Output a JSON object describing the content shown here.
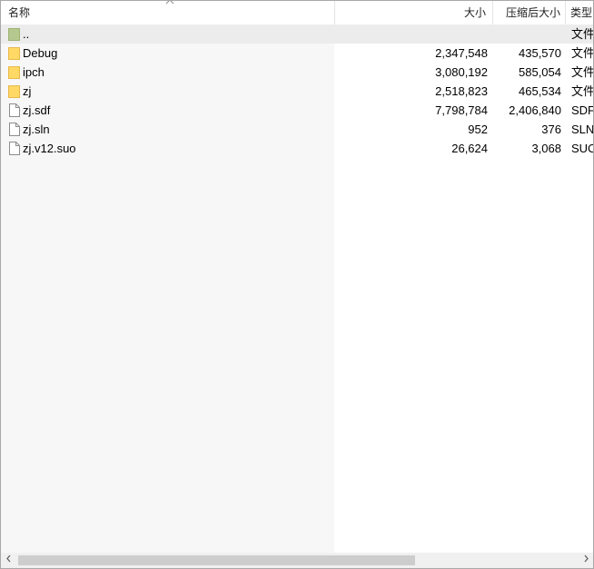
{
  "header": {
    "name": "名称",
    "size": "大小",
    "packed": "压缩后大小",
    "type": "类型",
    "sort_indicator": "^"
  },
  "rows": [
    {
      "icon": "parent-folder-icon",
      "name": "..",
      "size": "",
      "packed": "",
      "type": "文件",
      "selected": true
    },
    {
      "icon": "folder-icon",
      "name": "Debug",
      "size": "2,347,548",
      "packed": "435,570",
      "type": "文件"
    },
    {
      "icon": "folder-icon",
      "name": "ipch",
      "size": "3,080,192",
      "packed": "585,054",
      "type": "文件"
    },
    {
      "icon": "folder-icon",
      "name": "zj",
      "size": "2,518,823",
      "packed": "465,534",
      "type": "文件"
    },
    {
      "icon": "file-icon",
      "name": "zj.sdf",
      "size": "7,798,784",
      "packed": "2,406,840",
      "type": "SDF"
    },
    {
      "icon": "file-icon",
      "name": "zj.sln",
      "size": "952",
      "packed": "376",
      "type": "SLN"
    },
    {
      "icon": "file-icon",
      "name": "zj.v12.suo",
      "size": "26,624",
      "packed": "3,068",
      "type": "SUC"
    }
  ],
  "scrollbar": {
    "left_arrow": "<",
    "right_arrow": ">",
    "thumb_fraction": 0.71
  },
  "colors": {
    "folder": "#ffd966",
    "folder_dark": "#e8b84a",
    "parent_folder": "#b5c98e",
    "selected_row": "#ececec",
    "name_column_bg": "#f7f7f7"
  }
}
